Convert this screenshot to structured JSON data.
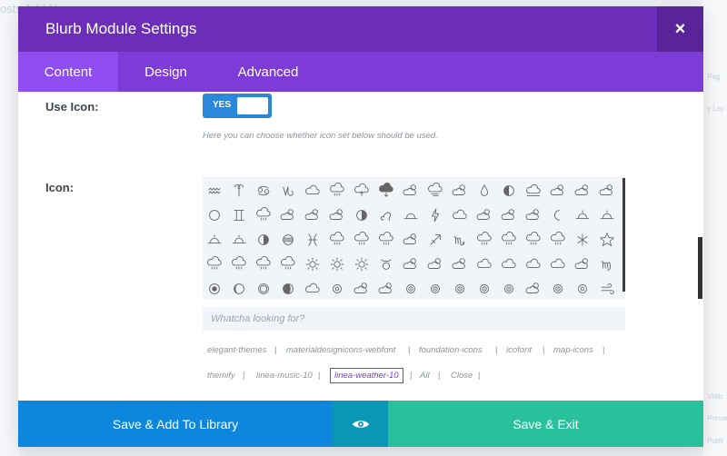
{
  "background": {
    "top_text": "osts   Add New",
    "right_texts": [
      "Pag",
      "y Lay",
      "Visib",
      "Previe",
      "Publi"
    ]
  },
  "modal": {
    "title": "Blurb Module Settings",
    "close_glyph": "×"
  },
  "tabs": [
    {
      "label": "Content",
      "active": true
    },
    {
      "label": "Design",
      "active": false
    },
    {
      "label": "Advanced",
      "active": false
    }
  ],
  "use_icon": {
    "label": "Use Icon:",
    "toggle_label": "YES",
    "help": "Here you can choose whether icon set below should be used."
  },
  "icon": {
    "label": "Icon:",
    "rows": [
      [
        "aquarius",
        "aries",
        "cancer",
        "capricorn",
        "cloud",
        "cloud-rain",
        "cloud-up",
        "cloud-down",
        "cloud-sun",
        "cloud-wind",
        "cloud-sun",
        "drop",
        "half-moon",
        "cloud-moon",
        "cloud-sun",
        "cloud-sun",
        "cloud-sun"
      ],
      [
        "circle",
        "gemini",
        "cloud-rain",
        "cloud-sun",
        "cloud-sun",
        "cloud-sun",
        "half-circle",
        "leo",
        "sunrise",
        "lightning",
        "cloud",
        "cloud-sun",
        "cloud-sun",
        "cloud-sun",
        "moon",
        "sunset",
        "sunset"
      ],
      [
        "sunset",
        "sunset",
        "half-circle",
        "striped-circle",
        "pisces",
        "cloud-rain",
        "cloud-rain",
        "cloud-rain",
        "cloud-sun",
        "sagittarius",
        "scorpio",
        "cloud-rain",
        "cloud-rain",
        "cloud-rain",
        "cloud-rain",
        "snowflake",
        "star"
      ],
      [
        "cloud-rain",
        "cloud-rain",
        "cloud-rain",
        "cloud-rain",
        "sun",
        "sun",
        "sun",
        "taurus",
        "cloud-sun",
        "cloud-sun",
        "cloud-sun",
        "cloud",
        "cloud",
        "cloud",
        "cloud",
        "cloud-sun",
        "virgo"
      ],
      [
        "circle-target",
        "moon-phase",
        "circle-ring",
        "moon-crescent",
        "cloud",
        "ring",
        "cloud-sun",
        "cloud-sun",
        "target",
        "target",
        "target",
        "target",
        "target",
        "cloud-sun",
        "target",
        "ring",
        "wind"
      ]
    ],
    "search_placeholder": "Whatcha looking for?"
  },
  "filters": [
    {
      "label": "elegant-themes",
      "active": false
    },
    {
      "label": "materialdesignicons-webfont",
      "active": false
    },
    {
      "label": "foundation-icons",
      "active": false
    },
    {
      "label": "icofont",
      "active": false
    },
    {
      "label": "map-icons",
      "active": false
    },
    {
      "label": "themify",
      "active": false
    },
    {
      "label": "linea-music-10",
      "active": false
    },
    {
      "label": "linea-weather-10",
      "active": true
    },
    {
      "label": "All",
      "active": false
    },
    {
      "label": "Close",
      "active": false
    }
  ],
  "footer": {
    "library_label": "Save & Add To Library",
    "eye_icon": "eye-icon",
    "save_label": "Save & Exit"
  },
  "colors": {
    "header": "#6c2eb9",
    "tabs": "#7d3cd8",
    "active_tab": "#8f4cf0",
    "toggle": "#2b87da",
    "library_button": "#0c87dd",
    "eye_button": "#0a96b5",
    "save_button": "#28c19b"
  }
}
